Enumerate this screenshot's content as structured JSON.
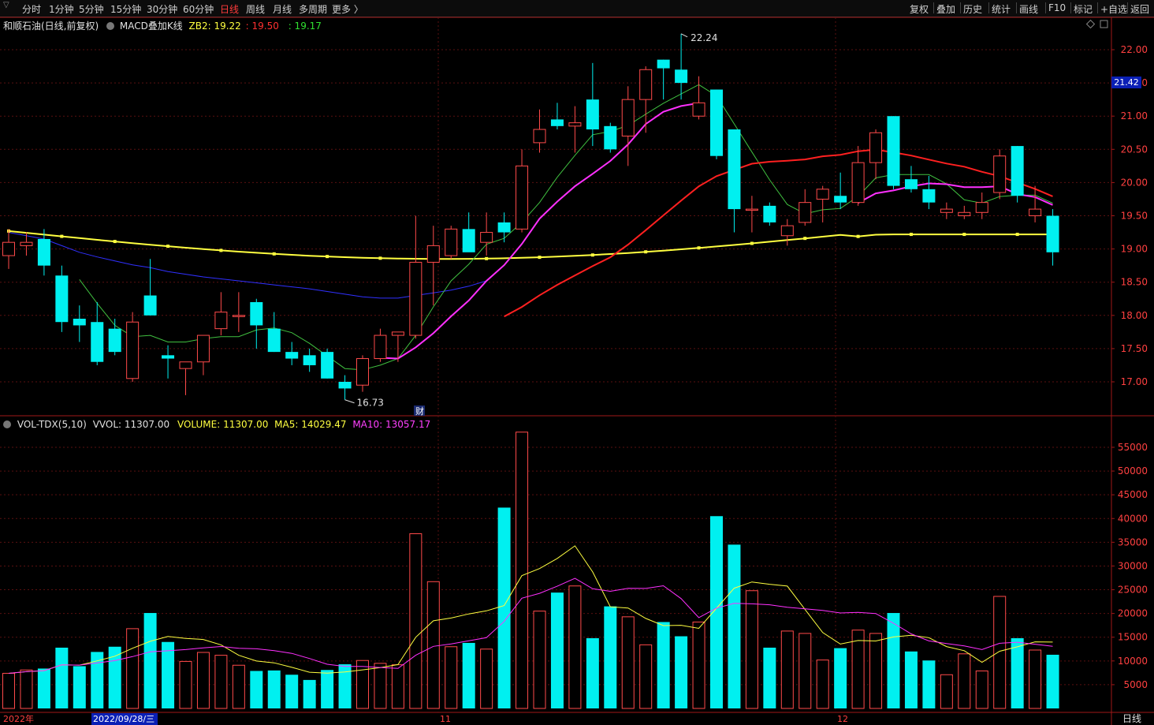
{
  "toolbar": {
    "left_items": [
      "分时",
      "1分钟",
      "5分钟",
      "15分钟",
      "30分钟",
      "60分钟",
      "日线",
      "周线",
      "月线",
      "多周期",
      "更多 〉"
    ],
    "active_index": 6,
    "right_items": [
      "复权",
      "叠加",
      "历史",
      "统计",
      "画线",
      "F10",
      "标记",
      "+自选",
      "返回"
    ]
  },
  "header": {
    "stock": "和顺石油(日线,前复权)",
    "indicator": "MACD叠加K线",
    "zb2_label": "ZB2: 19.22",
    "val2": ": 19.50",
    "val3": ": 19.17"
  },
  "vol_header": {
    "name": "VOL-TDX(5,10)",
    "vvol": "VVOL: 11307.00",
    "volume": "VOLUME: 11307.00",
    "ma5": "MA5: 14029.47",
    "ma10": "MA10: 13057.17"
  },
  "annotations": {
    "high": "22.24",
    "low": "16.73",
    "fin": "财"
  },
  "current_price": "21.42",
  "bottom": {
    "year": "2022年",
    "date_cursor": "2022/09/28/三",
    "m11": "11",
    "m12": "12",
    "period": "日线"
  },
  "colors": {
    "up": "#ff4a4a",
    "down": "#00f0f0",
    "ma_yellow": "#ffff40",
    "ma_red": "#ff2020",
    "ma_magenta": "#ff30ff",
    "ma_green": "#40c040",
    "ma_blue": "#3030ff"
  },
  "chart_data": {
    "type": "candlestick",
    "price_axis": {
      "ticks": [
        17.0,
        17.5,
        18.0,
        18.5,
        19.0,
        19.5,
        20.0,
        20.5,
        21.0,
        21.5,
        22.0
      ],
      "ylim": [
        16.5,
        22.5
      ]
    },
    "volume_axis": {
      "ticks": [
        5000,
        10000,
        15000,
        20000,
        25000,
        30000,
        35000,
        40000,
        45000,
        50000,
        55000
      ],
      "ylim": [
        0,
        60000
      ]
    },
    "candles": [
      {
        "o": 18.9,
        "h": 19.3,
        "l": 18.7,
        "c": 19.1,
        "v": 7400
      },
      {
        "o": 19.05,
        "h": 19.25,
        "l": 18.9,
        "c": 19.1,
        "v": 8100
      },
      {
        "o": 19.15,
        "h": 19.3,
        "l": 18.6,
        "c": 18.75,
        "v": 8400
      },
      {
        "o": 18.6,
        "h": 18.75,
        "l": 17.75,
        "c": 17.9,
        "v": 12800
      },
      {
        "o": 17.95,
        "h": 18.15,
        "l": 17.6,
        "c": 17.85,
        "v": 8900
      },
      {
        "o": 17.9,
        "h": 18.2,
        "l": 17.25,
        "c": 17.3,
        "v": 11900
      },
      {
        "o": 17.8,
        "h": 17.95,
        "l": 17.4,
        "c": 17.45,
        "v": 13000
      },
      {
        "o": 17.05,
        "h": 18.05,
        "l": 17.0,
        "c": 17.9,
        "v": 16800
      },
      {
        "o": 18.3,
        "h": 18.85,
        "l": 18.0,
        "c": 18.0,
        "v": 20100
      },
      {
        "o": 17.4,
        "h": 17.55,
        "l": 17.05,
        "c": 17.35,
        "v": 14000
      },
      {
        "o": 17.2,
        "h": 17.3,
        "l": 16.8,
        "c": 17.3,
        "v": 9900
      },
      {
        "o": 17.3,
        "h": 17.7,
        "l": 17.1,
        "c": 17.7,
        "v": 11800
      },
      {
        "o": 17.8,
        "h": 18.35,
        "l": 17.7,
        "c": 18.05,
        "v": 11200
      },
      {
        "o": 18.0,
        "h": 18.35,
        "l": 17.75,
        "c": 18.0,
        "v": 9100
      },
      {
        "o": 18.2,
        "h": 18.25,
        "l": 17.5,
        "c": 17.85,
        "v": 7900
      },
      {
        "o": 17.8,
        "h": 18.05,
        "l": 17.45,
        "c": 17.45,
        "v": 8000
      },
      {
        "o": 17.45,
        "h": 17.6,
        "l": 17.25,
        "c": 17.35,
        "v": 7100
      },
      {
        "o": 17.4,
        "h": 17.5,
        "l": 17.15,
        "c": 17.25,
        "v": 6000
      },
      {
        "o": 17.45,
        "h": 17.5,
        "l": 17.05,
        "c": 17.05,
        "v": 8100
      },
      {
        "o": 17.0,
        "h": 17.1,
        "l": 16.73,
        "c": 16.9,
        "v": 9300
      },
      {
        "o": 16.95,
        "h": 17.4,
        "l": 16.85,
        "c": 17.35,
        "v": 10100
      },
      {
        "o": 17.35,
        "h": 17.8,
        "l": 17.3,
        "c": 17.7,
        "v": 9500
      },
      {
        "o": 17.7,
        "h": 17.75,
        "l": 17.3,
        "c": 17.75,
        "v": 9200
      },
      {
        "o": 17.7,
        "h": 19.5,
        "l": 17.65,
        "c": 18.8,
        "v": 36800
      },
      {
        "o": 18.8,
        "h": 19.35,
        "l": 18.15,
        "c": 19.05,
        "v": 26700
      },
      {
        "o": 18.9,
        "h": 19.35,
        "l": 18.85,
        "c": 19.3,
        "v": 13000
      },
      {
        "o": 19.3,
        "h": 19.55,
        "l": 19.0,
        "c": 18.95,
        "v": 13800
      },
      {
        "o": 19.1,
        "h": 19.55,
        "l": 18.9,
        "c": 19.25,
        "v": 12500
      },
      {
        "o": 19.4,
        "h": 19.55,
        "l": 19.1,
        "c": 19.25,
        "v": 42300
      },
      {
        "o": 19.3,
        "h": 20.5,
        "l": 19.25,
        "c": 20.25,
        "v": 58200
      },
      {
        "o": 20.6,
        "h": 21.1,
        "l": 20.45,
        "c": 20.8,
        "v": 20500
      },
      {
        "o": 20.95,
        "h": 21.2,
        "l": 20.8,
        "c": 20.85,
        "v": 24400
      },
      {
        "o": 20.85,
        "h": 21.15,
        "l": 20.45,
        "c": 20.9,
        "v": 25800
      },
      {
        "o": 21.25,
        "h": 21.8,
        "l": 20.55,
        "c": 20.8,
        "v": 14800
      },
      {
        "o": 20.85,
        "h": 20.9,
        "l": 20.45,
        "c": 20.5,
        "v": 21500
      },
      {
        "o": 20.7,
        "h": 21.45,
        "l": 20.25,
        "c": 21.25,
        "v": 19300
      },
      {
        "o": 21.25,
        "h": 21.75,
        "l": 20.75,
        "c": 21.7,
        "v": 13400
      },
      {
        "o": 21.85,
        "h": 21.85,
        "l": 21.25,
        "c": 21.72,
        "v": 18200
      },
      {
        "o": 21.7,
        "h": 22.24,
        "l": 21.25,
        "c": 21.5,
        "v": 15200
      },
      {
        "o": 21.0,
        "h": 21.6,
        "l": 20.95,
        "c": 21.2,
        "v": 18200
      },
      {
        "o": 21.4,
        "h": 21.4,
        "l": 20.35,
        "c": 20.4,
        "v": 40500
      },
      {
        "o": 20.8,
        "h": 20.8,
        "l": 19.25,
        "c": 19.6,
        "v": 34500
      },
      {
        "o": 19.6,
        "h": 19.8,
        "l": 19.25,
        "c": 19.6,
        "v": 24800
      },
      {
        "o": 19.65,
        "h": 19.7,
        "l": 19.35,
        "c": 19.4,
        "v": 12800
      },
      {
        "o": 19.2,
        "h": 19.45,
        "l": 19.05,
        "c": 19.35,
        "v": 16300
      },
      {
        "o": 19.4,
        "h": 19.9,
        "l": 19.35,
        "c": 19.7,
        "v": 15800
      },
      {
        "o": 19.75,
        "h": 19.95,
        "l": 19.4,
        "c": 19.9,
        "v": 10200
      },
      {
        "o": 19.8,
        "h": 20.15,
        "l": 19.6,
        "c": 19.7,
        "v": 12700
      },
      {
        "o": 19.7,
        "h": 20.55,
        "l": 19.65,
        "c": 20.3,
        "v": 16500
      },
      {
        "o": 20.3,
        "h": 20.8,
        "l": 20.05,
        "c": 20.75,
        "v": 15800
      },
      {
        "o": 21.0,
        "h": 21.0,
        "l": 19.9,
        "c": 19.95,
        "v": 20100
      },
      {
        "o": 20.05,
        "h": 20.25,
        "l": 19.85,
        "c": 19.9,
        "v": 12000
      },
      {
        "o": 19.9,
        "h": 20.1,
        "l": 19.6,
        "c": 19.7,
        "v": 10100
      },
      {
        "o": 19.55,
        "h": 19.7,
        "l": 19.45,
        "c": 19.6,
        "v": 7100
      },
      {
        "o": 19.5,
        "h": 19.65,
        "l": 19.45,
        "c": 19.55,
        "v": 11500
      },
      {
        "o": 19.55,
        "h": 19.85,
        "l": 19.45,
        "c": 19.7,
        "v": 7900
      },
      {
        "o": 19.85,
        "h": 20.5,
        "l": 19.75,
        "c": 20.4,
        "v": 23600
      },
      {
        "o": 20.55,
        "h": 20.55,
        "l": 19.7,
        "c": 19.8,
        "v": 14800
      },
      {
        "o": 19.5,
        "h": 19.95,
        "l": 19.4,
        "c": 19.6,
        "v": 12300
      },
      {
        "o": 19.5,
        "h": 19.6,
        "l": 18.75,
        "c": 18.95,
        "v": 11307
      }
    ]
  }
}
